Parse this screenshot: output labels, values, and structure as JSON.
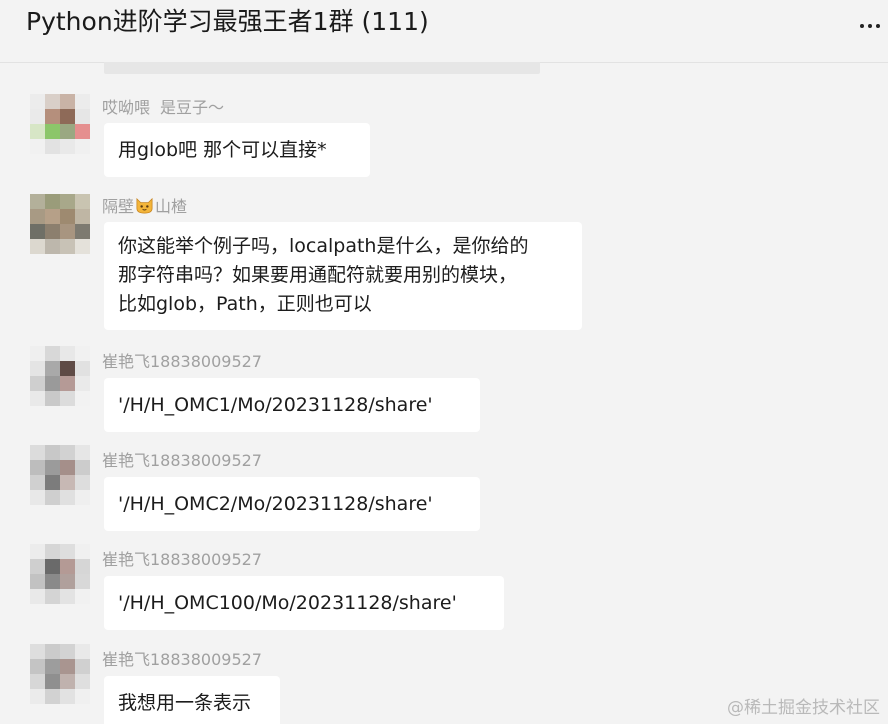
{
  "header": {
    "title": "Python进阶学习最强王者1群 (111)",
    "more_icon": "more-horizontal-icon"
  },
  "messages": [
    {
      "sender": "哎呦喂",
      "remark": "是豆子～",
      "lines": [
        "用glob吧  那个可以直接*"
      ]
    },
    {
      "sender_prefix": "隔壁",
      "sender_emoji": "cat-face-emoji",
      "sender_suffix": "山楂",
      "lines": [
        "你这能举个例子吗，localpath是什么，是你给的",
        "那字符串吗？如果要用通配符就要用别的模块，",
        "比如glob，Path，正则也可以"
      ]
    },
    {
      "sender": "崔艳飞18838009527",
      "lines": [
        "'/H/H_OMC1/Mo/20231128/share'"
      ]
    },
    {
      "sender": "崔艳飞18838009527",
      "lines": [
        "'/H/H_OMC2/Mo/20231128/share'"
      ]
    },
    {
      "sender": "崔艳飞18838009527",
      "lines": [
        "'/H/H_OMC100/Mo/20231128/share'"
      ]
    },
    {
      "sender": "崔艳飞18838009527",
      "lines": [
        "我想用一条表示"
      ]
    }
  ],
  "watermark": "@稀土掘金技术社区"
}
